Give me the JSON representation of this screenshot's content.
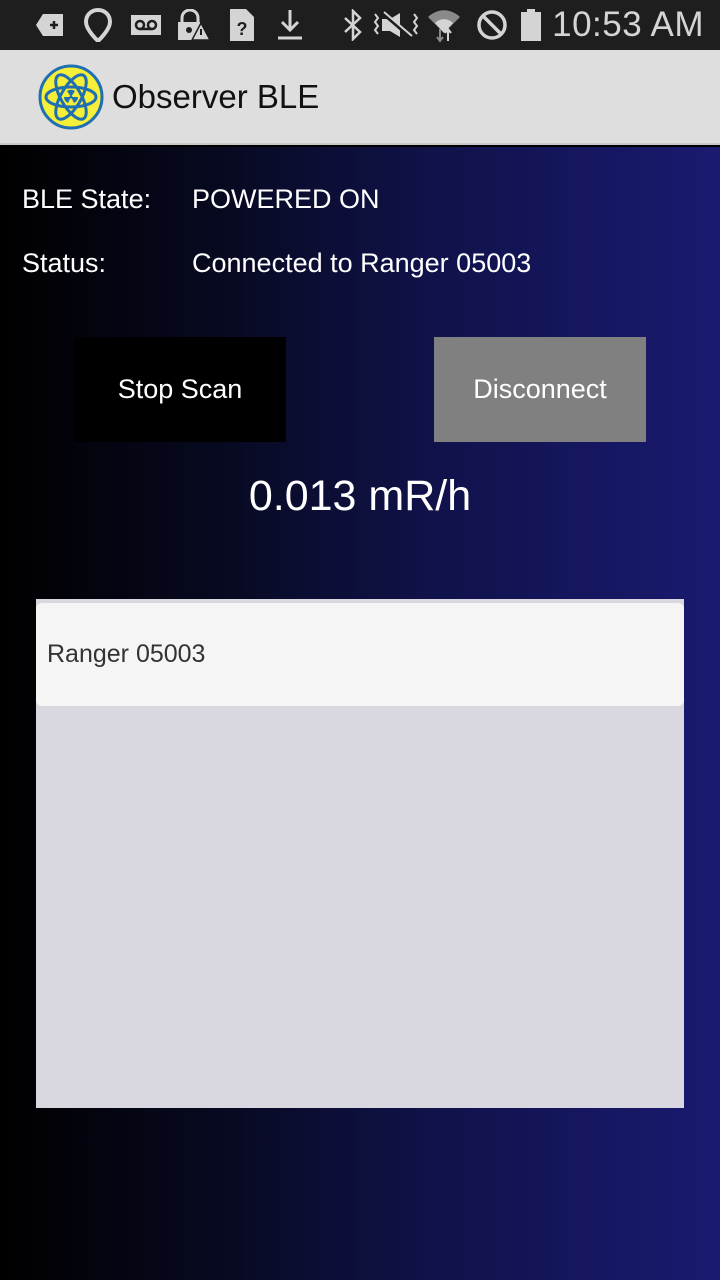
{
  "status_bar": {
    "left_icons": [
      "add-notification-icon",
      "location-pin-icon",
      "voicemail-icon",
      "lock-warning-icon",
      "unknown-sim-icon",
      "download-icon"
    ],
    "right_icons": [
      "bluetooth-icon",
      "vibrate-mute-icon",
      "wifi-icon",
      "do-not-disturb-icon",
      "battery-icon"
    ],
    "time": "10:53 AM"
  },
  "app_bar": {
    "logo": "atom-radiation-logo",
    "title": "Observer BLE"
  },
  "info": {
    "ble_state_label": "BLE State:",
    "ble_state_value": "POWERED ON",
    "status_label": "Status:",
    "status_value": "Connected to Ranger 05003"
  },
  "buttons": {
    "stop_scan": "Stop Scan",
    "disconnect": "Disconnect"
  },
  "reading": "0.013 mR/h",
  "devices": [
    {
      "name": "Ranger 05003"
    }
  ],
  "colors": {
    "app_bar_bg": "#dedede",
    "logo_yellow": "#f5ef3a",
    "logo_blue": "#1f6fb2",
    "gradient_start": "#000000",
    "gradient_end": "#1a1a70",
    "disconnect_bg": "#808080",
    "stop_scan_bg": "#000000",
    "list_bg": "#d9d8e0",
    "list_item_bg": "#f5f5f5"
  }
}
